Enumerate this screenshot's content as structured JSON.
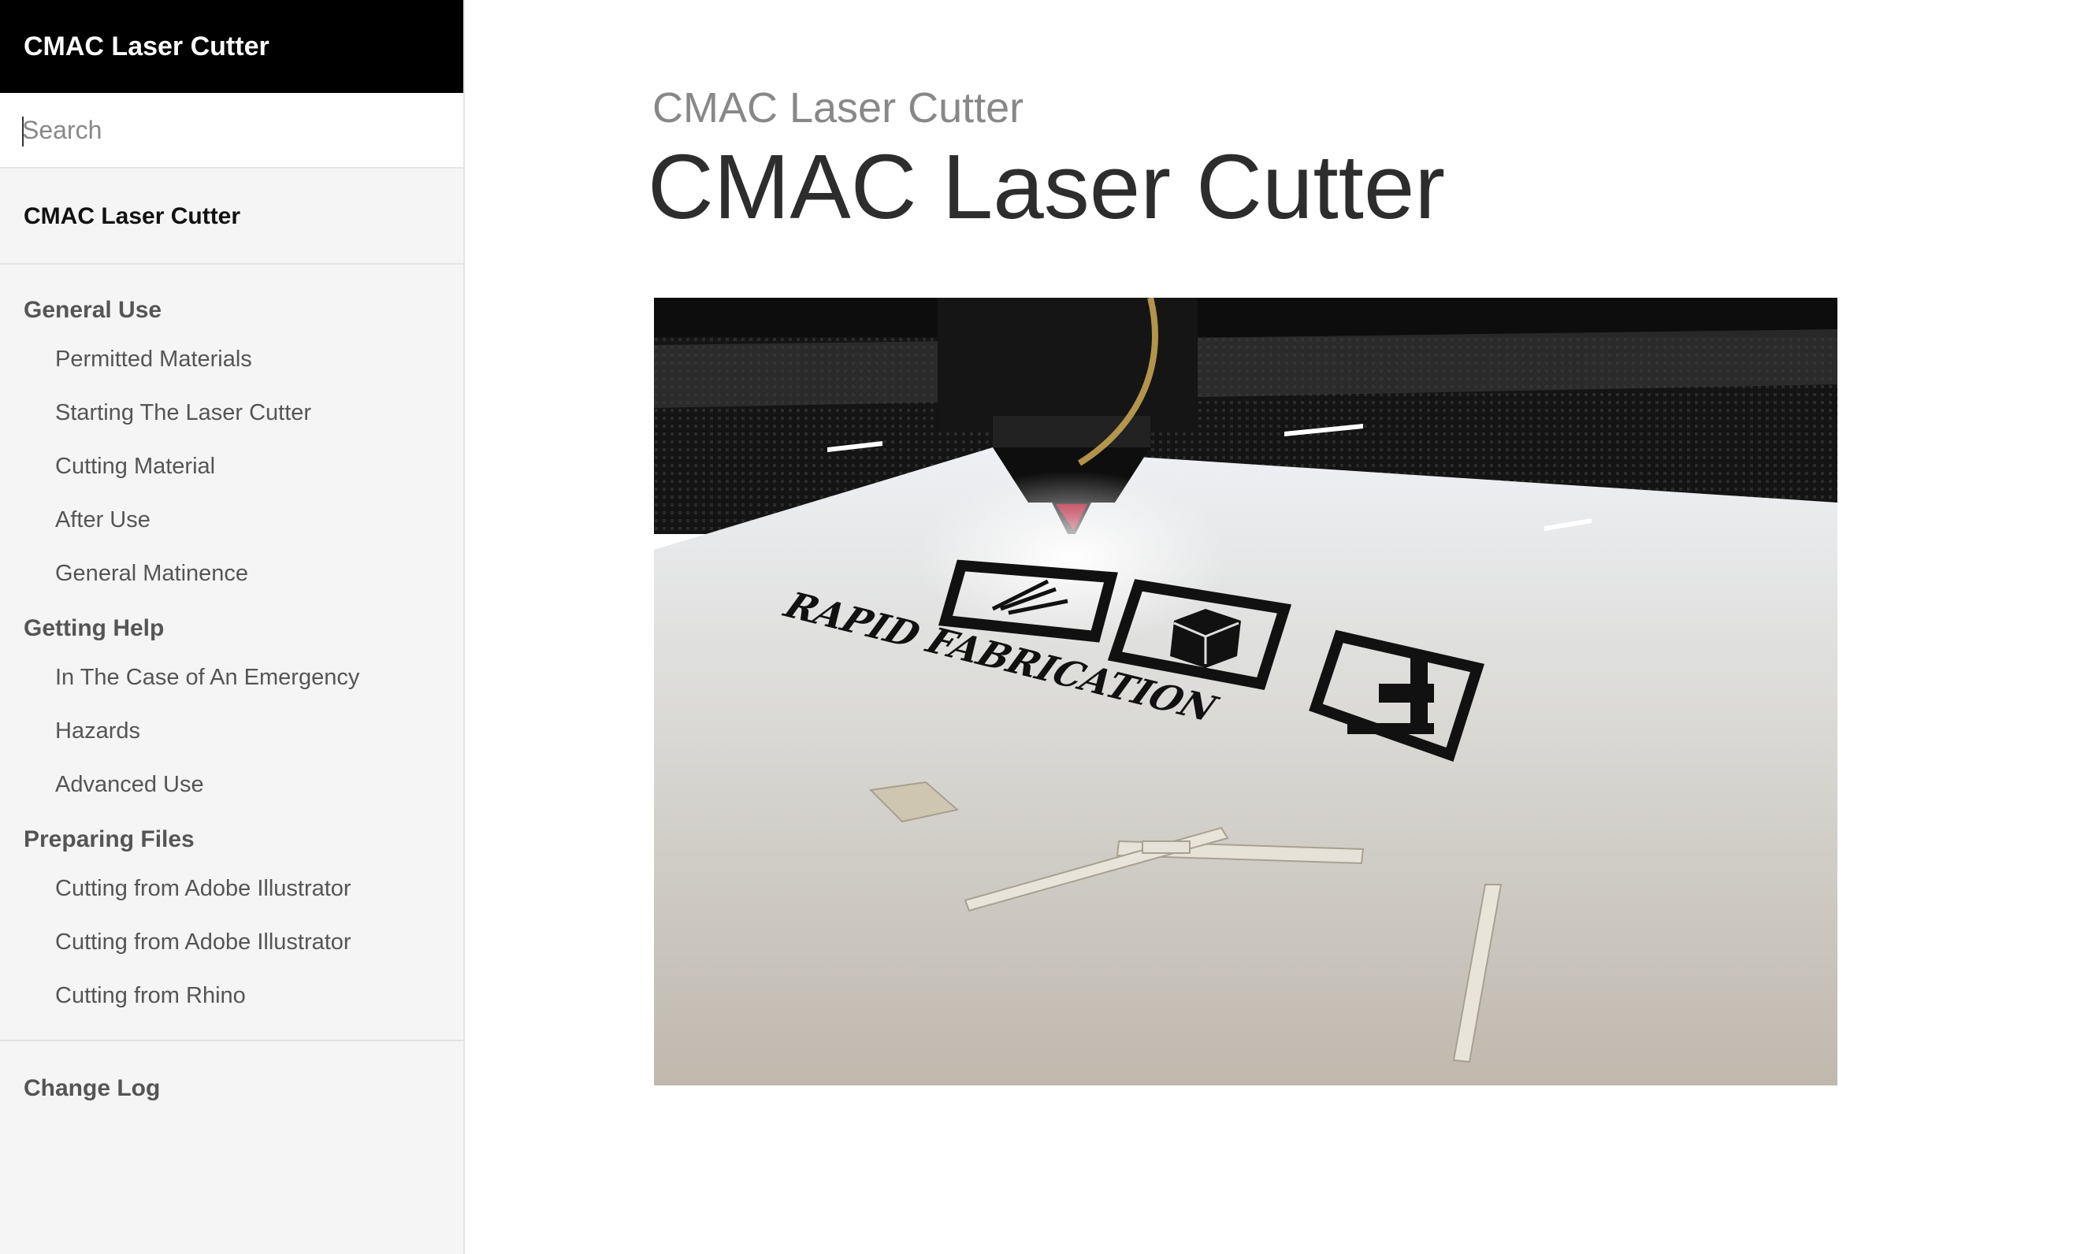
{
  "sidebar": {
    "brand": "CMAC Laser Cutter",
    "search": {
      "placeholder": "Search",
      "value": ""
    },
    "home_link": "CMAC Laser Cutter",
    "groups": [
      {
        "title": "General Use",
        "items": [
          "Permitted Materials",
          "Starting The Laser Cutter",
          "Cutting Material",
          "After Use",
          "General Matinence"
        ]
      },
      {
        "title": "Getting Help",
        "items": [
          "In The Case of An Emergency",
          "Hazards",
          "Advanced Use"
        ]
      },
      {
        "title": "Preparing Files",
        "items": [
          "Cutting from Adobe Illustrator",
          "Cutting from Adobe Illustrator",
          "Cutting from Rhino"
        ]
      }
    ],
    "footer_link": "Change Log"
  },
  "main": {
    "kicker": "CMAC Laser Cutter",
    "title": "CMAC Laser Cutter",
    "hero_image": {
      "engraved_text": "RAPID FABRICATION"
    }
  },
  "colors": {
    "brand_bg": "#000000",
    "sidebar_bg": "#f5f5f5",
    "laser_red": "#e0002a"
  },
  "icons": [
    "laser-icon",
    "cube-icon",
    "robot-arm-icon"
  ]
}
